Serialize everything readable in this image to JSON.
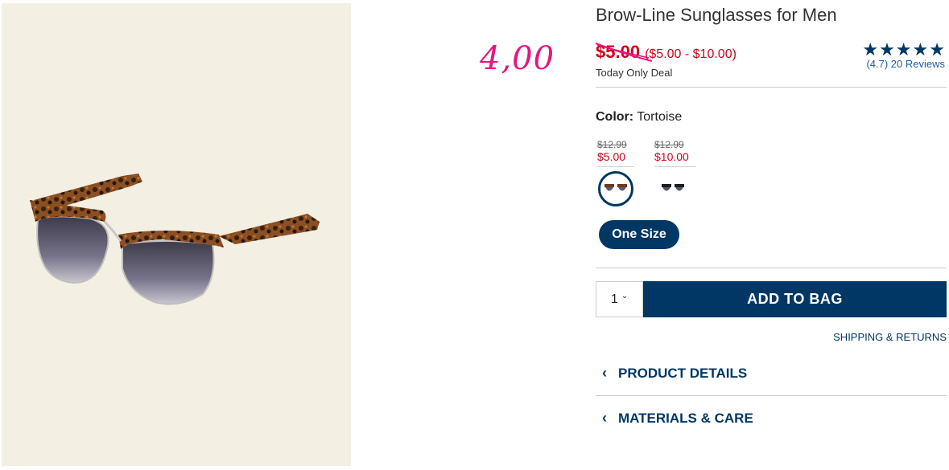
{
  "annotation": {
    "handwritten_price": "4,00",
    "color": "#e8157d"
  },
  "product": {
    "title": "Brow-Line Sunglasses for Men",
    "sale_price": "$5.00",
    "price_range": "($5.00 - $10.00)",
    "deal_label": "Today Only Deal",
    "rating_value": "(4.7)",
    "reviews_label": "20 Reviews",
    "stars": [
      "★",
      "★",
      "★",
      "★",
      "★"
    ]
  },
  "color_picker": {
    "label": "Color:",
    "value": "Tortoise",
    "swatches": [
      {
        "old_price": "$12.99",
        "new_price": "$5.00",
        "name": "tortoise",
        "selected": true
      },
      {
        "old_price": "$12.99",
        "new_price": "$10.00",
        "name": "black",
        "selected": false
      }
    ]
  },
  "size": {
    "label": "One Size"
  },
  "cart": {
    "quantity": "1",
    "add_label": "ADD TO BAG"
  },
  "links": {
    "shipping": "SHIPPING & RETURNS"
  },
  "accordions": [
    {
      "label": "PRODUCT DETAILS"
    },
    {
      "label": "MATERIALS & CARE"
    }
  ],
  "colors": {
    "brand_navy": "#003764",
    "sale_red": "#d0021b",
    "image_bg": "#f3efe2"
  },
  "icons": {
    "star": "star-icon",
    "chevron_down": "chevron-down-icon",
    "chevron_left": "chevron-left-icon"
  }
}
